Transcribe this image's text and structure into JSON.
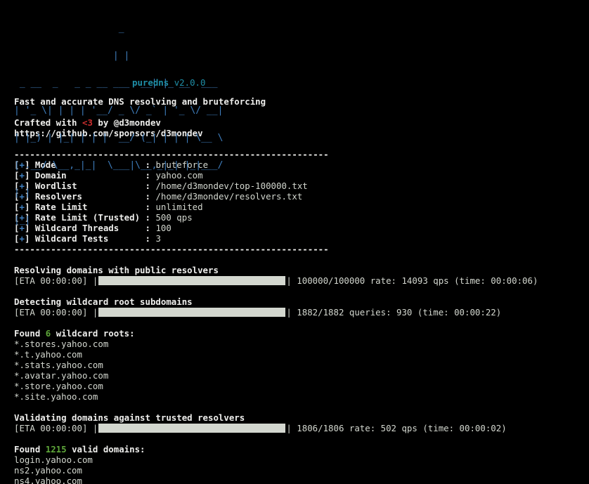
{
  "banner": {
    "ascii_lines": [
      "                   _",
      "                  | |",
      " _ __  _   _ _ __ ___  __| |_ __  ___",
      "| '_ \\| | | | '__/ _ \\/ _` | '_ \\/ __|",
      "| |_) | |_| | | |  __/ (_| | | | \\__ \\",
      "| .__/ \\__,_|_|  \\___|\\__,_|_| |_|___/",
      "| |",
      "|_|"
    ],
    "name": "puredns",
    "version": "v2.0.0"
  },
  "tagline": "Fast and accurate DNS resolving and bruteforcing",
  "credits": {
    "prefix": "Crafted with ",
    "heart": "<3",
    "suffix": " by @d3mondev",
    "url": "https://github.com/sponsors/d3mondev"
  },
  "separator": "------------------------------------------------------------",
  "config": [
    {
      "bullet": "+",
      "key": "Mode                 ",
      "value": "bruteforce"
    },
    {
      "bullet": "+",
      "key": "Domain               ",
      "value": "yahoo.com"
    },
    {
      "bullet": "+",
      "key": "Wordlist             ",
      "value": "/home/d3mondev/top-100000.txt"
    },
    {
      "bullet": "+",
      "key": "Resolvers            ",
      "value": "/home/d3mondev/resolvers.txt"
    },
    {
      "bullet": "+",
      "key": "Rate Limit           ",
      "value": "unlimited"
    },
    {
      "bullet": "+",
      "key": "Rate Limit (Trusted) ",
      "value": "500 qps"
    },
    {
      "bullet": "+",
      "key": "Wildcard Threads     ",
      "value": "100"
    },
    {
      "bullet": "+",
      "key": "Wildcard Tests       ",
      "value": "3"
    }
  ],
  "steps": [
    {
      "title": "Resolving domains with public resolvers",
      "eta": "[ETA 00:00:00]",
      "progress": 1.0,
      "stats": "100000/100000 rate: 14093 qps (time: 00:00:06)"
    },
    {
      "title": "Detecting wildcard root subdomains",
      "eta": "[ETA 00:00:00]",
      "progress": 1.0,
      "stats": "1882/1882 queries: 930 (time: 00:00:22)"
    }
  ],
  "wildcards": {
    "prefix": "Found ",
    "count": "6",
    "suffix": " wildcard roots:",
    "items": [
      "*.stores.yahoo.com",
      "*.t.yahoo.com",
      "*.stats.yahoo.com",
      "*.avatar.yahoo.com",
      "*.store.yahoo.com",
      "*.site.yahoo.com"
    ]
  },
  "validation": {
    "title": "Validating domains against trusted resolvers",
    "eta": "[ETA 00:00:00]",
    "progress": 1.0,
    "stats": "1806/1806 rate: 502 qps (time: 00:00:02)"
  },
  "valid": {
    "prefix": "Found ",
    "count": "1215",
    "suffix": " valid domains:",
    "items": [
      "login.yahoo.com",
      "ns2.yahoo.com",
      "ns4.yahoo.com"
    ]
  },
  "colors": {
    "background": "#000000",
    "text": "#d3d7cf",
    "banner": "#3f7fbf",
    "heart": "#cc2e2e",
    "count": "#5fa83a",
    "bullet": "#3f7fbf"
  }
}
